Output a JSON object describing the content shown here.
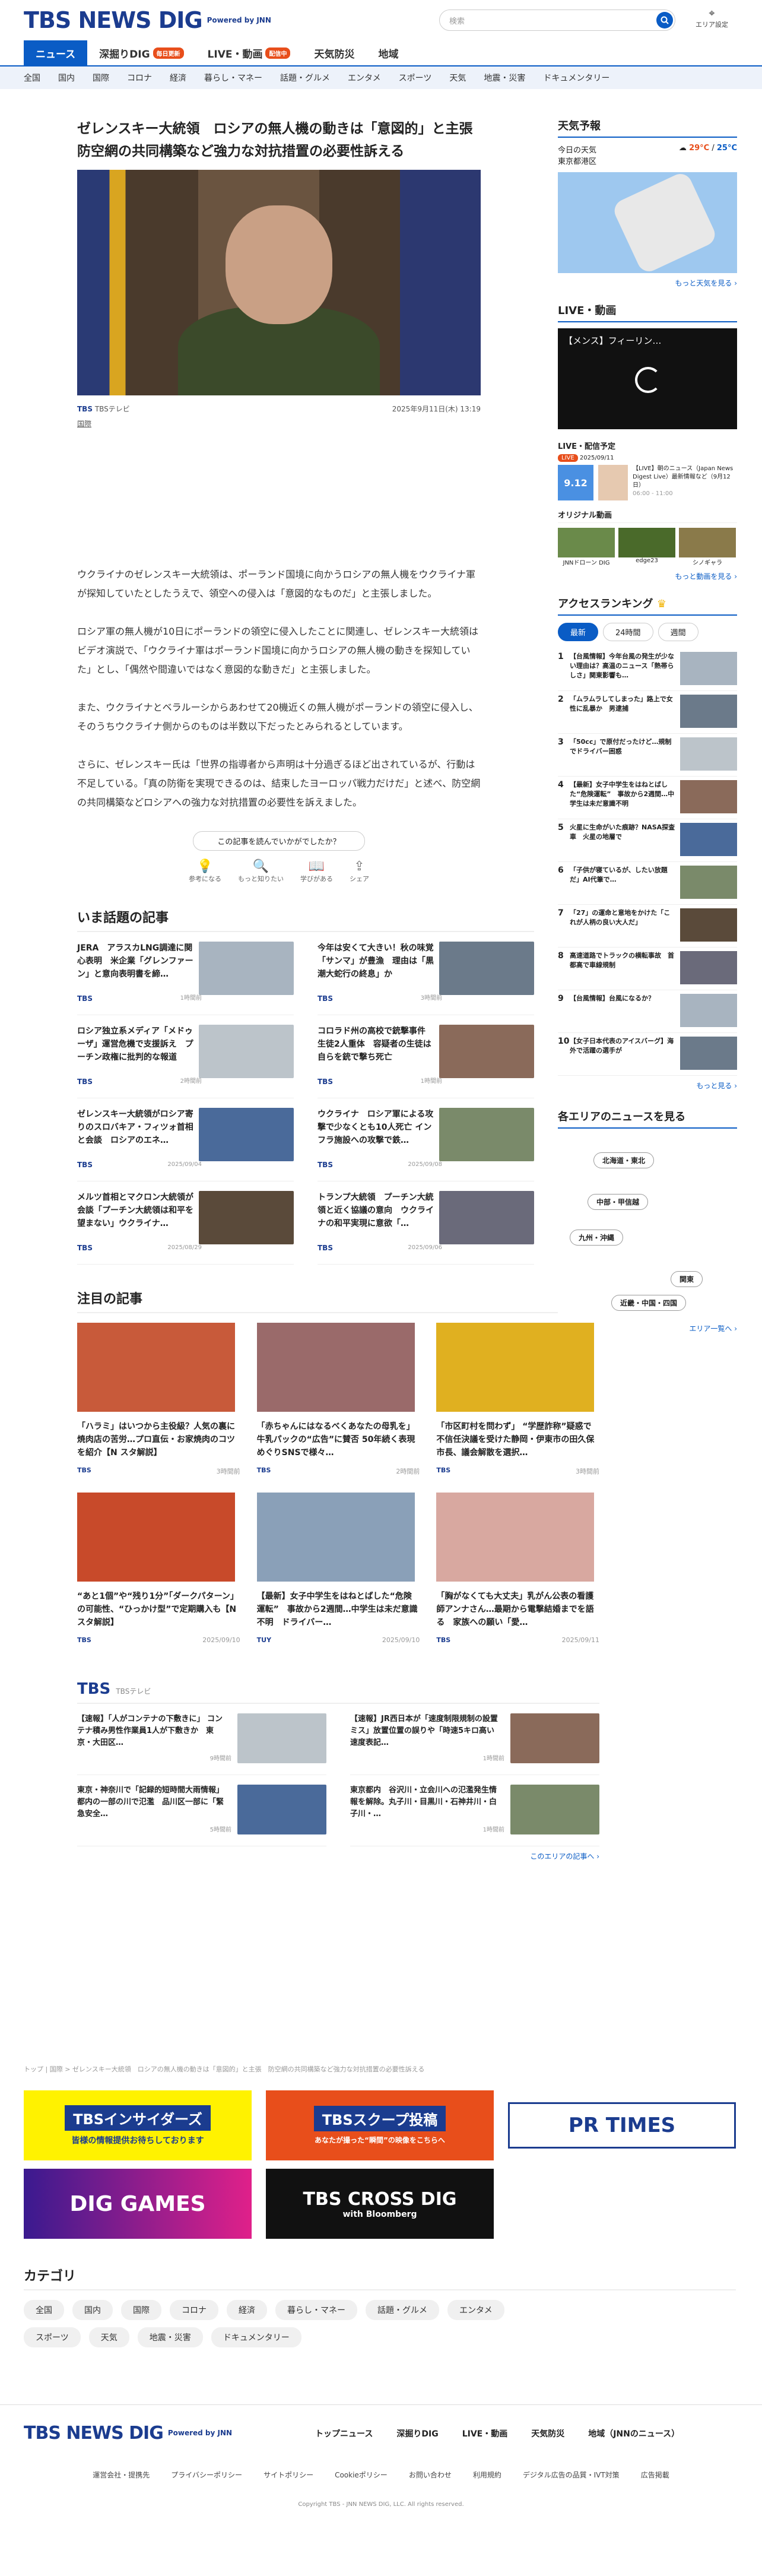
{
  "header": {
    "logo": "TBS NEWS DIG",
    "powered": "Powered by JNN",
    "search_placeholder": "検索",
    "area_label": "エリア設定"
  },
  "nav": {
    "tabs": [
      {
        "label": "ニュース"
      },
      {
        "label": "深掘りDIG",
        "badge": "毎日更新"
      },
      {
        "label": "LIVE・動画",
        "badge": "配信中"
      },
      {
        "label": "天気防災"
      },
      {
        "label": "地域"
      }
    ],
    "categories": [
      "全国",
      "国内",
      "国際",
      "コロナ",
      "経済",
      "暮らし・マネー",
      "話題・グルメ",
      "エンタメ",
      "スポーツ",
      "天気",
      "地震・災害",
      "ドキュメンタリー"
    ]
  },
  "article": {
    "title": "ゼレンスキー大統領　ロシアの無人機の動きは「意図的」と主張　防空網の共同構築など強力な対抗措置の必要性訴える",
    "source": "TBSテレビ",
    "date": "2025年9月11日(木) 13:19",
    "category": "国際",
    "paragraphs": [
      "ウクライナのゼレンスキー大統領は、ポーランド国境に向かうロシアの無人機をウクライナ軍が探知していたとしたうえで、領空への侵入は「意図的なものだ」と主張しました。",
      "ロシア軍の無人機が10日にポーランドの領空に侵入したことに関連し、ゼレンスキー大統領はビデオ演説で、「ウクライナ軍はポーランド国境に向かうロシアの無人機の動きを探知していた」とし、「偶然や間違いではなく意図的な動きだ」と主張しました。",
      "また、ウクライナとベラルーシからあわせて20機近くの無人機がポーランドの領空に侵入し、そのうちウクライナ側からのものは半数以下だったとみられるとしています。",
      "さらに、ゼレンスキー氏は「世界の指導者から声明は十分過ぎるほど出されているが、行動は不足している。「真の防衛を実現できるのは、結束したヨーロッパ戦力だけだ」と述べ、防空網の共同構築などロシアへの強力な対抗措置の必要性を訴えました。"
    ],
    "survey": "この記事を読んでいかがでしたか？",
    "reactions": [
      "参考になる",
      "もっと知りたい",
      "学びがある",
      "シェア"
    ]
  },
  "hot": {
    "title": "いま話題の記事",
    "items": [
      {
        "t": "JERA　アラスカLNG調達に関心表明　米企業「グレンファーン」と意向表明書を締…",
        "m": "TBS",
        "d": "1時間前"
      },
      {
        "t": "今年は安くて大きい！秋の味覚「サンマ」が豊漁　理由は「黒潮大蛇行の終息」か",
        "m": "TBS",
        "d": "3時間前"
      },
      {
        "t": "ロシア独立系メディア「メドゥーザ」運営危機で支援訴え　プーチン政権に批判的な報道",
        "m": "TBS",
        "d": "2時間前"
      },
      {
        "t": "コロラド州の高校で銃撃事件 生徒2人重体　容疑者の生徒は自らを銃で撃ち死亡",
        "m": "TBS",
        "d": "1時間前"
      },
      {
        "t": "ゼレンスキー大統領がロシア寄りのスロバキア・フィツォ首相と会談　ロシアのエネ…",
        "m": "TBS",
        "d": "2025/09/04"
      },
      {
        "t": "ウクライナ　ロシア軍による攻撃で少なくとも10人死亡 インフラ施設への攻撃で鉄…",
        "m": "TBS",
        "d": "2025/09/08"
      },
      {
        "t": "メルツ首相とマクロン大統領が会談「プーチン大統領は和平を望まない」ウクライナ…",
        "m": "TBS",
        "d": "2025/08/29"
      },
      {
        "t": "トランプ大統領　プーチン大統領と近く協議の意向　ウクライナの和平実現に意欲「…",
        "m": "TBS",
        "d": "2025/09/06"
      }
    ]
  },
  "featured": {
    "title": "注目の記事",
    "items": [
      {
        "t": "「ハラミ」はいつから主役級？人気の裏に焼肉店の苦労…プロ直伝・お家焼肉のコツを紹介【N スタ解説】",
        "m": "TBS",
        "d": "3時間前"
      },
      {
        "t": "「赤ちゃんにはなるべくあなたの母乳を」牛乳パックの“広告”に賛否 50年続く表現めぐりSNSで様々…",
        "m": "TBS",
        "d": "2時間前"
      },
      {
        "t": "「市区町村を問わず」 “学歴詐称”疑惑で不信任決議を受けた静岡・伊東市の田久保市長、議会解散を選択…",
        "m": "TBS",
        "d": "3時間前"
      },
      {
        "t": "“あと1個”や“残り1分”「ダークパターン」の可能性、“ひっかけ型”で定期購入も【N スタ解説】",
        "m": "TBS",
        "d": "2025/09/10"
      },
      {
        "t": "【最新】女子中学生をはねとばした“危険運転”　事故から2週間…中学生は未だ意識不明　ドライバー…",
        "m": "TUY",
        "d": "2025/09/10"
      },
      {
        "t": "「胸がなくても大丈夫」乳がん公表の看護師アンナさん…最期から電撃結婚までを語る　家族への願い「愛…",
        "m": "TBS",
        "d": "2025/09/11"
      }
    ]
  },
  "tbs_block": {
    "logo": "TBS",
    "sub": "TBSテレビ",
    "items": [
      {
        "t": "【速報】「人がコンテナの下敷きに」 コンテナ積み男性作業員1人が下敷きか　東京・大田区…",
        "d": "9時間前"
      },
      {
        "t": "【速報】JR西日本が「速度制限規制の設置ミス」放置位置の誤りや「時速5キロ高い速度表記…",
        "d": "1時間前"
      },
      {
        "t": "東京・神奈川で「記録的短時間大雨情報」都内の一部の川で氾濫　品川区一部に「緊急安全…",
        "d": "5時間前"
      },
      {
        "t": "東京都内　谷沢川・立会川への氾濫発生情報を解除。丸子川・目黒川・石神井川・白子川・…",
        "d": "1時間前"
      }
    ],
    "more": "このエリアの記事へ ›"
  },
  "breadcrumb": "トップ | 国際 > ゼレンスキー大統領　ロシアの無人機の動きは「意図的」と主張　防空網の共同構築など強力な対抗措置の必要性訴える",
  "banners": [
    {
      "t": "TBSインサイダーズ",
      "s": "皆様の情報提供お待ちしております"
    },
    {
      "t": "TBSスクープ投稿",
      "s": "あなたが撮った“瞬間”の映像をこちらへ"
    },
    {
      "t": "PR TIMES"
    },
    {
      "t": "DIG GAMES"
    },
    {
      "t": "TBS CROSS DIG",
      "s": "with Bloomberg"
    }
  ],
  "category_sec": {
    "title": "カテゴリ",
    "chips": [
      "全国",
      "国内",
      "国際",
      "コロナ",
      "経済",
      "暮らし・マネー",
      "話題・グルメ",
      "エンタメ",
      "スポーツ",
      "天気",
      "地震・災害",
      "ドキュメンタリー"
    ]
  },
  "footer": {
    "nav": [
      "トップニュース",
      "深掘りDIG",
      "LIVE・動画",
      "天気防災",
      "地域（JNNのニュース）"
    ],
    "links": [
      "運営会社・提携先",
      "プライバシーポリシー",
      "サイトポリシー",
      "Cookieポリシー",
      "お問い合わせ",
      "利用規約",
      "デジタル広告の品質・IVT対策",
      "広告掲載"
    ],
    "copyright": "Copyright TBS - JNN NEWS DIG, LLC. All rights reserved."
  },
  "sidebar": {
    "weather": {
      "title": "天気予報",
      "date": "今日の天気",
      "area": "東京都港区",
      "hi": "29°C",
      "lo": "25°C",
      "link": "もっと天気を見る ›"
    },
    "live": {
      "title": "LIVE・動画",
      "video_title": "【メンス】フィーリン…",
      "sub": "LIVE・配信予定",
      "tag": "LIVE",
      "date": "2025/09/11",
      "pv_date": "9.12",
      "pv_t": "【LIVE】朝のニュース（Japan News Digest Live）最新情報など（9月12日）",
      "pv_time": "06:00 - 11:00",
      "orig": "オリジナル動画",
      "vids": [
        "JNNドローン DIG",
        "edge23",
        "シノギャラ"
      ],
      "more": "もっと動画を見る ›"
    },
    "ranking": {
      "title": "アクセスランキング",
      "tabs": [
        "最新",
        "24時間",
        "週間"
      ],
      "items": [
        "【台風情報】今年台風の発生が少ない理由は？高温のニュース「熱帯らしさ」関東影響も…",
        "「ムラムラしてしまった」路上で女性に乱暴か　男逮捕",
        "「50cc」で原付だったけど…規制でドライバー困惑",
        "【最新】女子中学生をはねとばした“危険運転”　事故から2週間…中学生は未だ意識不明",
        "火星に生命がいた痕跡？NASA探査車　火星の地層で",
        "「子供が寝ているが、したい放題だ」AI代筆で…",
        "「27」の運命と意地をかけた「これが人柄の良い大人だ」",
        "高速道路でトラックの横転事故　首都高で車線規制",
        "【台風情報】台風になるか？",
        "【女子日本代表のアイスバーグ】海外で活躍の選手が"
      ],
      "more": "もっと見る ›"
    },
    "area": {
      "title": "各エリアのニュースを見る",
      "btns": [
        "北海道・東北",
        "中部・甲信越",
        "九州・沖縄",
        "関東",
        "近畿・中国・四国"
      ],
      "link": "エリア一覧へ ›"
    }
  }
}
